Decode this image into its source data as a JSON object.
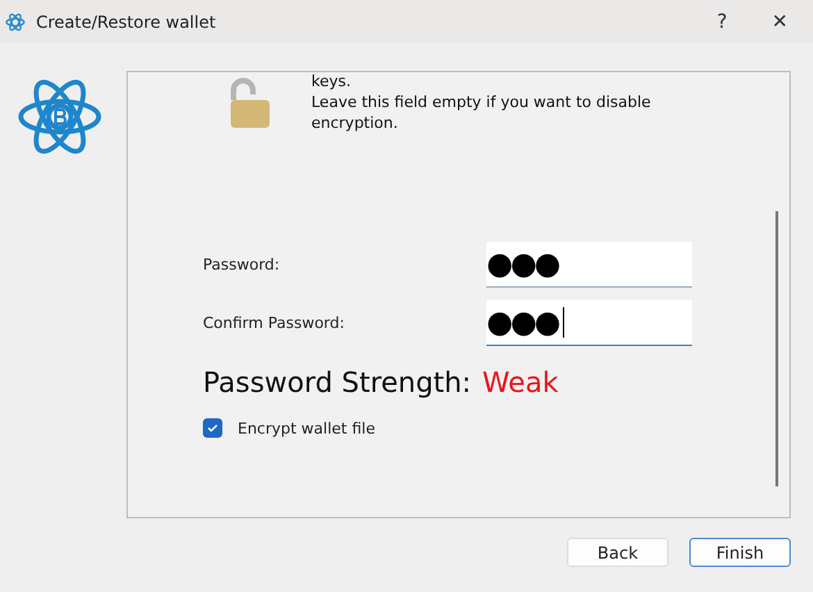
{
  "window": {
    "title": "Create/Restore wallet",
    "help": "?",
    "close": "✕"
  },
  "message": {
    "lines": [
      "keys.",
      "Leave this field empty if you want to disable encryption."
    ]
  },
  "fields": [
    {
      "label": "Password:",
      "value": "●●●",
      "focused": false
    },
    {
      "label": "Confirm Password:",
      "value": "●●●",
      "focused": true
    }
  ],
  "strength": {
    "label": "Password Strength:",
    "value": "Weak",
    "color": "#e8151b"
  },
  "encrypt": {
    "label": "Encrypt wallet file",
    "checked": true
  },
  "buttons": [
    {
      "label": "Back",
      "default": false
    },
    {
      "label": "Finish",
      "default": true
    }
  ]
}
